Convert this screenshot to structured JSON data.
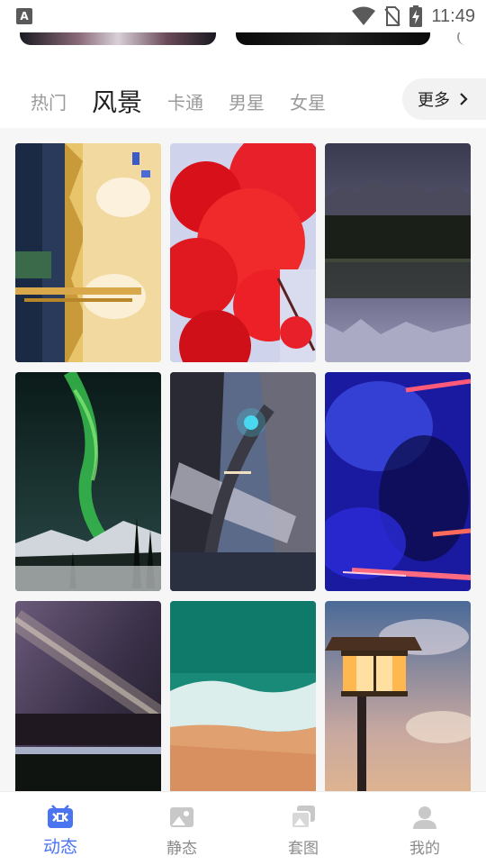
{
  "status_bar": {
    "notification_glyph": "A",
    "time": "11:49",
    "icons": [
      "wifi-icon",
      "no-sim-icon",
      "battery-charging-icon"
    ]
  },
  "category_tabs": [
    {
      "label": "热门",
      "active": false
    },
    {
      "label": "风景",
      "active": true
    },
    {
      "label": "卡通",
      "active": false
    },
    {
      "label": "男星",
      "active": false
    },
    {
      "label": "女星",
      "active": false
    }
  ],
  "more_button": {
    "label": "更多",
    "icon": "chevron-right-icon"
  },
  "wallpapers": [
    {
      "subject": "golden-city-reflection"
    },
    {
      "subject": "red-maple-leaves"
    },
    {
      "subject": "mountain-lake-reflection"
    },
    {
      "subject": "aurora-over-snow"
    },
    {
      "subject": "skyscrapers-looking-up"
    },
    {
      "subject": "blue-neon-meteors"
    },
    {
      "subject": "milky-way-night"
    },
    {
      "subject": "beach-waves-aerial"
    },
    {
      "subject": "street-lamp-sunset"
    }
  ],
  "bottom_nav": [
    {
      "label": "动态",
      "icon": "live-wallpaper-icon",
      "active": true
    },
    {
      "label": "静态",
      "icon": "image-icon",
      "active": false
    },
    {
      "label": "套图",
      "icon": "image-set-icon",
      "active": false
    },
    {
      "label": "我的",
      "icon": "user-icon",
      "active": false
    }
  ],
  "colors": {
    "accent": "#4a74f0",
    "inactive_text": "#8a8a8a",
    "active_tab": "#222222",
    "inactive_tab": "#9a9a9a"
  }
}
